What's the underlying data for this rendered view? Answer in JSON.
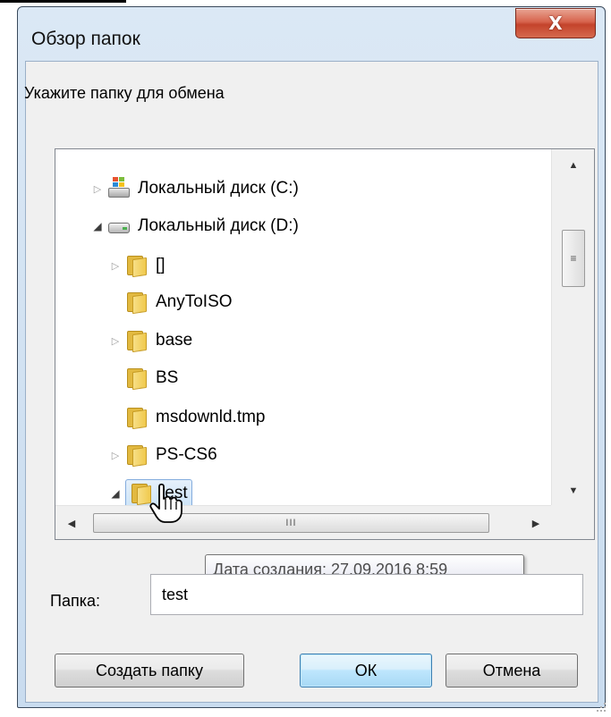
{
  "window": {
    "title": "Обзор папок",
    "close_label": "X"
  },
  "instruction": "Укажите папку для обмена",
  "tree": {
    "items": [
      {
        "label": "Локальный диск (C:)",
        "icon": "windows-drive-icon",
        "expander": "collapsed"
      },
      {
        "label": "Локальный диск (D:)",
        "icon": "hard-drive-icon",
        "expander": "expanded"
      },
      {
        "label": "[]",
        "icon": "folder-icon",
        "expander": "collapsed"
      },
      {
        "label": "AnyToISO",
        "icon": "folder-icon",
        "expander": "none"
      },
      {
        "label": "base",
        "icon": "folder-icon",
        "expander": "collapsed"
      },
      {
        "label": "BS",
        "icon": "folder-icon",
        "expander": "none"
      },
      {
        "label": "msdownld.tmp",
        "icon": "folder-icon",
        "expander": "none"
      },
      {
        "label": "PS-CS6",
        "icon": "folder-icon",
        "expander": "collapsed"
      },
      {
        "label": "test",
        "icon": "folder-icon",
        "expander": "expanded",
        "selected": true
      }
    ]
  },
  "scrollbar": {
    "vertical_thumb_grip": "≡",
    "horizontal_thumb_grip": "III"
  },
  "tooltip": "Дата создания: 27.09.2016 8:59",
  "folder_field": {
    "label": "Папка:",
    "value": "test"
  },
  "buttons": {
    "create_folder": "Создать папку",
    "ok": "ОК",
    "cancel": "Отмена"
  },
  "colors": {
    "close_button": "#c4432b",
    "selection": "#cde4f8",
    "folder": "#f0c94d"
  }
}
